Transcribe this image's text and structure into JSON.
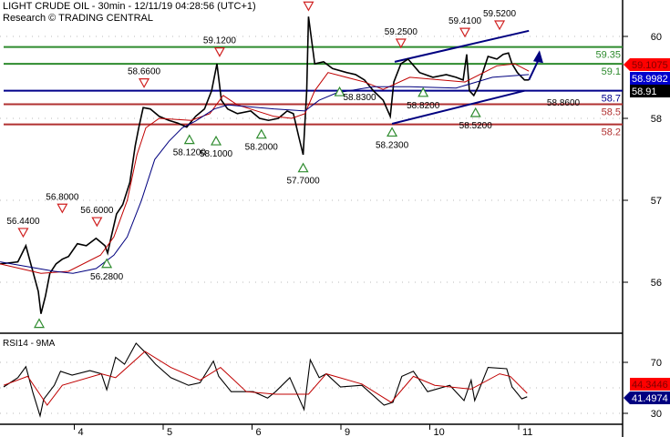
{
  "header": {
    "title": "LIGHT CRUDE OIL - 30min - 12/11/19 04:28:56 (UTC+1)",
    "subtitle": "Research © TRADING CENTRAL"
  },
  "colors": {
    "price": "#000000",
    "ma_short": "#c00000",
    "ma_long": "#00007f",
    "support_resistance_green": "#2e8b2e",
    "pivot_blue": "#00008b",
    "support_red": "#b03030",
    "marker_up": "#2e8b2e",
    "marker_down": "#d02020",
    "rsi_ma": "#c00000"
  },
  "chart_data": [
    {
      "type": "line",
      "panel": "price",
      "x_unit": "trading day index (0 = 4, 1 = 5, 2 = 6, 3 = 9, 4 = 10, 5 = 11)",
      "x_ticks": [
        {
          "t": 0,
          "label": "4"
        },
        {
          "t": 1,
          "label": "5"
        },
        {
          "t": 2,
          "label": "6"
        },
        {
          "t": 3,
          "label": "9"
        },
        {
          "t": 4,
          "label": "10"
        },
        {
          "t": 5,
          "label": "11"
        }
      ],
      "y_ticks": [
        "60",
        "58",
        "57",
        "56"
      ],
      "grid": true,
      "series": [
        {
          "name": "Price",
          "color": "#000000",
          "points": [
            [
              -0.84,
              56.13
            ],
            [
              -0.64,
              56.16
            ],
            [
              -0.55,
              56.4
            ],
            [
              -0.48,
              56.06
            ],
            [
              -0.41,
              55.72
            ],
            [
              -0.38,
              55.39
            ],
            [
              -0.33,
              55.65
            ],
            [
              -0.28,
              55.99
            ],
            [
              -0.21,
              56.13
            ],
            [
              -0.14,
              56.2
            ],
            [
              -0.07,
              56.24
            ],
            [
              0.03,
              56.43
            ],
            [
              0.13,
              56.4
            ],
            [
              0.24,
              56.51
            ],
            [
              0.34,
              56.4
            ],
            [
              0.37,
              56.29
            ],
            [
              0.41,
              56.53
            ],
            [
              0.47,
              56.87
            ],
            [
              0.54,
              57.01
            ],
            [
              0.62,
              57.34
            ],
            [
              0.68,
              57.88
            ],
            [
              0.72,
              58.15
            ],
            [
              0.77,
              58.45
            ],
            [
              0.85,
              58.43
            ],
            [
              0.95,
              58.32
            ],
            [
              1.06,
              58.26
            ],
            [
              1.16,
              58.22
            ],
            [
              1.26,
              58.16
            ],
            [
              1.36,
              58.32
            ],
            [
              1.46,
              58.43
            ],
            [
              1.54,
              58.7
            ],
            [
              1.6,
              59.1
            ],
            [
              1.65,
              58.56
            ],
            [
              1.72,
              58.43
            ],
            [
              1.83,
              58.36
            ],
            [
              1.98,
              58.4
            ],
            [
              2.08,
              58.29
            ],
            [
              2.18,
              58.26
            ],
            [
              2.29,
              58.29
            ],
            [
              2.39,
              58.4
            ],
            [
              2.46,
              58.36
            ],
            [
              2.52,
              58.02
            ],
            [
              2.57,
              57.75
            ],
            [
              2.61,
              58.7
            ],
            [
              2.63,
              59.8
            ],
            [
              2.7,
              59.1
            ],
            [
              2.8,
              59.13
            ],
            [
              2.9,
              59.03
            ],
            [
              3.06,
              58.97
            ],
            [
              3.16,
              58.94
            ],
            [
              3.26,
              58.86
            ],
            [
              3.36,
              58.7
            ],
            [
              3.47,
              58.56
            ],
            [
              3.55,
              58.32
            ],
            [
              3.59,
              58.83
            ],
            [
              3.67,
              59.1
            ],
            [
              3.75,
              59.17
            ],
            [
              3.88,
              58.97
            ],
            [
              4.03,
              58.9
            ],
            [
              4.18,
              58.94
            ],
            [
              4.29,
              58.9
            ],
            [
              4.37,
              58.86
            ],
            [
              4.41,
              59.24
            ],
            [
              4.44,
              58.7
            ],
            [
              4.49,
              58.63
            ],
            [
              4.54,
              58.76
            ],
            [
              4.59,
              58.97
            ],
            [
              4.65,
              59.21
            ],
            [
              4.75,
              59.17
            ],
            [
              4.82,
              59.24
            ],
            [
              4.88,
              59.26
            ],
            [
              4.92,
              59.1
            ],
            [
              4.98,
              58.97
            ],
            [
              5.06,
              58.86
            ],
            [
              5.11,
              58.86
            ]
          ]
        },
        {
          "name": "MA short",
          "color": "#c00000",
          "points": [
            [
              -0.84,
              56.13
            ],
            [
              -0.38,
              55.99
            ],
            [
              -0.07,
              56.02
            ],
            [
              0.29,
              56.26
            ],
            [
              0.44,
              56.53
            ],
            [
              0.59,
              57.07
            ],
            [
              0.7,
              57.75
            ],
            [
              0.8,
              58.15
            ],
            [
              0.95,
              58.29
            ],
            [
              1.31,
              58.26
            ],
            [
              1.52,
              58.36
            ],
            [
              1.67,
              58.63
            ],
            [
              1.83,
              58.49
            ],
            [
              2.24,
              58.32
            ],
            [
              2.44,
              58.29
            ],
            [
              2.59,
              58.36
            ],
            [
              2.7,
              58.7
            ],
            [
              2.85,
              58.97
            ],
            [
              3.26,
              58.83
            ],
            [
              3.47,
              58.72
            ],
            [
              3.77,
              58.9
            ],
            [
              4.39,
              58.83
            ],
            [
              4.75,
              59.07
            ],
            [
              4.95,
              59.1
            ],
            [
              5.11,
              58.99
            ]
          ]
        },
        {
          "name": "MA long",
          "color": "#00007f",
          "points": [
            [
              -0.84,
              56.16
            ],
            [
              -0.23,
              56.02
            ],
            [
              -0.02,
              55.99
            ],
            [
              0.24,
              56.06
            ],
            [
              0.44,
              56.26
            ],
            [
              0.59,
              56.53
            ],
            [
              0.75,
              57.07
            ],
            [
              0.9,
              57.68
            ],
            [
              1.06,
              57.95
            ],
            [
              1.21,
              58.15
            ],
            [
              1.36,
              58.25
            ],
            [
              1.57,
              58.43
            ],
            [
              1.72,
              58.49
            ],
            [
              2.24,
              58.43
            ],
            [
              2.59,
              58.4
            ],
            [
              2.75,
              58.56
            ],
            [
              2.95,
              58.67
            ],
            [
              3.36,
              58.76
            ],
            [
              3.77,
              58.76
            ],
            [
              4.29,
              58.74
            ],
            [
              4.7,
              58.9
            ],
            [
              5.11,
              58.94
            ]
          ]
        }
      ],
      "levels": [
        {
          "value": 59.35,
          "label": "59.35",
          "color": "#2e8b2e"
        },
        {
          "value": 59.1,
          "label": "59.1",
          "color": "#2e8b2e"
        },
        {
          "value": 58.7,
          "label": "58.7",
          "color": "#00008b"
        },
        {
          "value": 58.5,
          "label": "58.5",
          "color": "#b03030"
        },
        {
          "value": 58.2,
          "label": "58.2",
          "color": "#b03030"
        }
      ],
      "markers": [
        {
          "t": -0.58,
          "price": 56.44,
          "dir": "down",
          "label": "56.4400"
        },
        {
          "t": -0.4,
          "price": 55.39,
          "dir": "up",
          "label": ""
        },
        {
          "t": -0.14,
          "price": 56.8,
          "dir": "down",
          "label": "56.8000"
        },
        {
          "t": 0.25,
          "price": 56.6,
          "dir": "down",
          "label": "56.6000"
        },
        {
          "t": 0.36,
          "price": 56.28,
          "dir": "up",
          "label": "56.2800"
        },
        {
          "t": 0.78,
          "price": 58.66,
          "dir": "down",
          "label": "58.6600"
        },
        {
          "t": 1.29,
          "price": 58.12,
          "dir": "up",
          "label": "58.1200"
        },
        {
          "t": 1.59,
          "price": 58.1,
          "dir": "up",
          "label": "58.1000"
        },
        {
          "t": 1.63,
          "price": 59.12,
          "dir": "down",
          "label": "59.1200"
        },
        {
          "t": 2.1,
          "price": 58.2,
          "dir": "up",
          "label": "58.2000"
        },
        {
          "t": 2.57,
          "price": 57.7,
          "dir": "up",
          "label": "57.7000"
        },
        {
          "t": 2.63,
          "price": 59.8,
          "dir": "down",
          "label": ""
        },
        {
          "t": 2.98,
          "price": 58.83,
          "dir": "up",
          "label": "58.8300"
        },
        {
          "t": 3.57,
          "price": 58.23,
          "dir": "up",
          "label": "58.2300"
        },
        {
          "t": 3.67,
          "price": 59.25,
          "dir": "down",
          "label": "59.2500"
        },
        {
          "t": 3.92,
          "price": 58.82,
          "dir": "up",
          "label": "58.8200"
        },
        {
          "t": 4.39,
          "price": 59.41,
          "dir": "down",
          "label": "59.4100"
        },
        {
          "t": 4.51,
          "price": 58.52,
          "dir": "up",
          "label": "58.5200"
        },
        {
          "t": 4.78,
          "price": 59.52,
          "dir": "down",
          "label": "59.5200"
        }
      ],
      "annotation_label": "58.8600",
      "channel": {
        "upper": [
          [
            3.6,
            59.13
          ],
          [
            5.11,
            59.59
          ]
        ],
        "lower": [
          [
            3.57,
            58.21
          ],
          [
            5.06,
            58.7
          ]
        ]
      },
      "arrow": [
        [
          5.11,
          58.86
        ],
        [
          5.23,
          59.3
        ]
      ],
      "badges": [
        {
          "label": "59.1075",
          "bg": "#ff0000",
          "fg": "#800000",
          "pointer": true
        },
        {
          "label": "58.9982",
          "bg": "#0000cc",
          "fg": "#ffffff",
          "pointer": false
        },
        {
          "label": "58.91",
          "bg": "#000000",
          "fg": "#ffffff",
          "pointer": false
        }
      ]
    },
    {
      "type": "line",
      "panel": "rsi",
      "title": "RSI14 - 9MA",
      "ylim": [
        0,
        100
      ],
      "y_ticks": [
        {
          "v": 70,
          "label": "70"
        },
        {
          "v": 50,
          "label": ""
        },
        {
          "v": 30,
          "label": "30"
        }
      ],
      "series": [
        {
          "name": "RSI14",
          "color": "#000000",
          "points": [
            [
              -0.8,
              50.7
            ],
            [
              -0.64,
              58
            ],
            [
              -0.55,
              66.6
            ],
            [
              -0.47,
              46
            ],
            [
              -0.39,
              28
            ],
            [
              -0.35,
              41
            ],
            [
              -0.23,
              52
            ],
            [
              -0.16,
              63
            ],
            [
              -0.03,
              60
            ],
            [
              0.17,
              63.5
            ],
            [
              0.3,
              61
            ],
            [
              0.36,
              48.5
            ],
            [
              0.46,
              74
            ],
            [
              0.56,
              68.5
            ],
            [
              0.69,
              85
            ],
            [
              0.79,
              78
            ],
            [
              0.91,
              68.5
            ],
            [
              1.08,
              58
            ],
            [
              1.28,
              52
            ],
            [
              1.41,
              54
            ],
            [
              1.56,
              71
            ],
            [
              1.62,
              59
            ],
            [
              1.76,
              47
            ],
            [
              2.01,
              47
            ],
            [
              2.17,
              42
            ],
            [
              2.26,
              47
            ],
            [
              2.42,
              58
            ],
            [
              2.58,
              33
            ],
            [
              2.65,
              72
            ],
            [
              2.75,
              58
            ],
            [
              2.83,
              61
            ],
            [
              2.99,
              50.7
            ],
            [
              3.23,
              52
            ],
            [
              3.48,
              36.4
            ],
            [
              3.58,
              38.6
            ],
            [
              3.68,
              59
            ],
            [
              3.81,
              63
            ],
            [
              3.97,
              47
            ],
            [
              4.22,
              52
            ],
            [
              4.38,
              40
            ],
            [
              4.46,
              56
            ],
            [
              4.5,
              40
            ],
            [
              4.65,
              66
            ],
            [
              4.86,
              65
            ],
            [
              4.92,
              50.7
            ],
            [
              5.03,
              41.4
            ],
            [
              5.09,
              43
            ]
          ]
        },
        {
          "name": "9MA",
          "color": "#c00000",
          "points": [
            [
              -0.8,
              52
            ],
            [
              -0.53,
              59
            ],
            [
              -0.31,
              36.4
            ],
            [
              -0.14,
              52
            ],
            [
              0.3,
              61
            ],
            [
              0.46,
              58
            ],
            [
              0.79,
              78.6
            ],
            [
              1.08,
              66
            ],
            [
              1.41,
              56
            ],
            [
              1.64,
              66
            ],
            [
              1.93,
              47
            ],
            [
              2.26,
              45
            ],
            [
              2.63,
              45
            ],
            [
              2.83,
              61
            ],
            [
              3.23,
              53
            ],
            [
              3.56,
              38.6
            ],
            [
              3.81,
              59
            ],
            [
              4.05,
              52
            ],
            [
              4.46,
              49
            ],
            [
              4.78,
              61
            ],
            [
              4.9,
              59
            ],
            [
              5.09,
              45.7
            ]
          ]
        }
      ],
      "badges": [
        {
          "label": "44.3446",
          "bg": "#ff0000",
          "fg": "#800000",
          "pointer": false
        },
        {
          "label": "41.4974",
          "bg": "#000080",
          "fg": "#ffffff",
          "pointer": true
        }
      ]
    }
  ]
}
